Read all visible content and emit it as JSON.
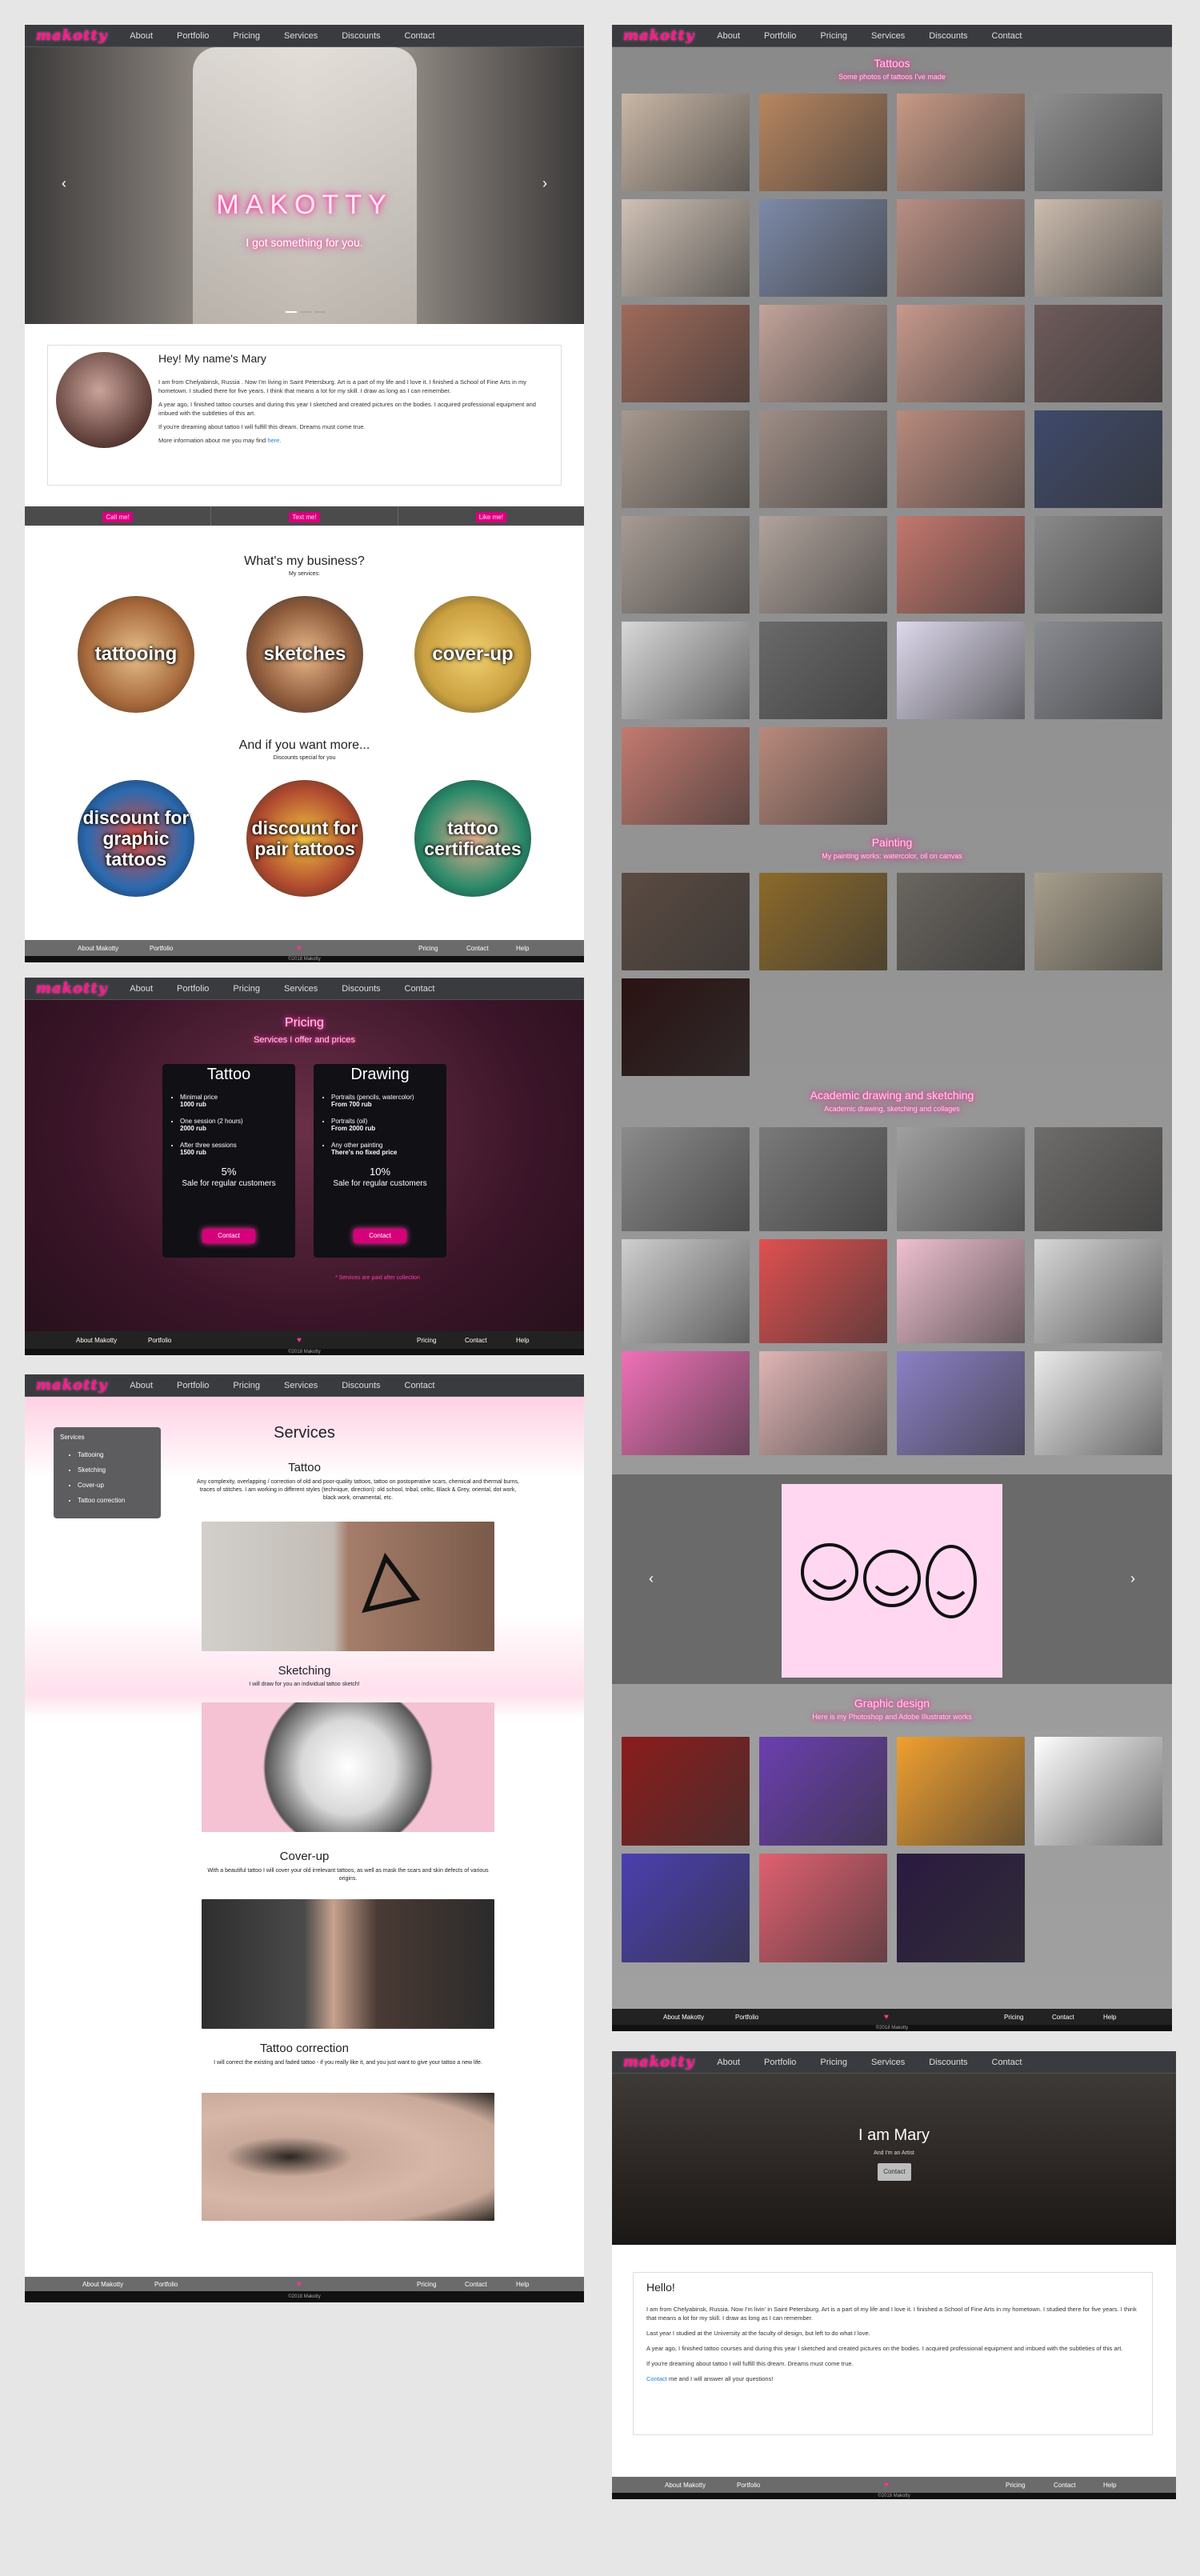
{
  "brand": {
    "logo": "makotty",
    "accent": "#ff1a8c"
  },
  "nav": [
    "About",
    "Portfolio",
    "Pricing",
    "Services",
    "Discounts",
    "Contact"
  ],
  "footer": {
    "about": "About Makotty",
    "portfolio": "Portfolio",
    "pricing": "Pricing",
    "contact": "Contact",
    "help": "Help",
    "copy": "©2018 Makotty"
  },
  "home": {
    "hero_title": "MAKOTTY",
    "hero_sub": "I got something for you.",
    "about_heading": "Hey! My name's Mary",
    "about_p1": "I am from Chelyabinsk, Russia . Now I'm living in Saint Petersburg. Art is a part of my life and I love it. I finished a School of Fine Arts in my hometown. I studied there for five years. I think that means a lot for my skill. I draw as long as I can remember.",
    "about_p2": "A year ago, I finished tattoo courses and during this year I sketched and created pictures on the bodies. I acquired professional equipment and imbued with the subtleties of this art.",
    "about_p3": "If you're dreaming about tattoo I will fulfill this dream. Dreams must come true.",
    "about_p4": "More information about me you may find",
    "about_link": "here.",
    "cta": [
      "Call me!",
      "Text me!",
      "Like me!"
    ],
    "business_title": "What's my business?",
    "business_sub": "My services:",
    "services": [
      "tattooing",
      "sketches",
      "cover-up"
    ],
    "more_title": "And if you want more...",
    "more_sub": "Discounts special for you",
    "discounts": [
      "discount for graphic tattoos",
      "discount for pair tattoos",
      "tattoo certificates"
    ]
  },
  "pricing": {
    "title": "Pricing",
    "sub": "Services I offer and prices",
    "cards": [
      {
        "name": "Tattoo",
        "items": [
          [
            "Minimal price",
            "1000 rub"
          ],
          [
            "One session (2 hours)",
            "2000 rub"
          ],
          [
            "After three sessions",
            "1500 rub"
          ]
        ],
        "sale": "5%",
        "sale_text": "Sale for regular customers",
        "btn": "Contact"
      },
      {
        "name": "Drawing",
        "items": [
          [
            "Portraits (pencils, watercolor)",
            "From 700 rub"
          ],
          [
            "Portraits (oil)",
            "From 2000 rub"
          ],
          [
            "Any other painting",
            "There's no fixed price"
          ]
        ],
        "sale": "10%",
        "sale_text": "Sale for regular customers",
        "btn": "Contact"
      }
    ],
    "note": "* Services are paid after collection"
  },
  "services": {
    "title": "Services",
    "menu_title": "Services",
    "menu": [
      "Tattooing",
      "Sketching",
      "Cover-up",
      "Tattoo correction"
    ],
    "sections": [
      {
        "h": "Tattoo",
        "p": "Any complexity, overlapping / correction of old and poor-quality tattoos, tattoo on postoperative scars, chemical and thermal burns, traces of stitches. I am working in different styles (technique, direction): old school, tribal, celtic, Black & Grey, oriental, dot work, black work, ornamental, etc."
      },
      {
        "h": "Sketching",
        "p": "I will draw for you an individual tattoo sketch!"
      },
      {
        "h": "Cover-up",
        "p": "With a beautiful tattoo I will cover your old irrelevant tattoos, as well as mask the scars and skin defects of various origins."
      },
      {
        "h": "Tattoo correction",
        "p": "I will correct the existing and faded tattoo - if you really like it, and you just want to give your tattoo a new life."
      }
    ]
  },
  "portfolio": {
    "tattoos_title": "Tattoos",
    "tattoos_sub": "Some photos of tattoos I've made",
    "painting_title": "Painting",
    "painting_sub": "My painting works: watercolor, oil on canvas",
    "academic_title": "Academic drawing and sketching",
    "academic_sub": "Academic drawing, sketching and collages",
    "graphic_title": "Graphic design",
    "graphic_sub": "Here is my Photoshop and Adobe Illustrator works",
    "tattoo_colors": [
      "#c9b7a6",
      "#b88660",
      "#c89a86",
      "#8f8f8f",
      "#cfc1b5",
      "#7d8aa8",
      "#b88f83",
      "#ccbcae",
      "#9e6a5a",
      "#c2a49a",
      "#c7998c",
      "#6f5b5b",
      "#a7998e",
      "#9f8e86",
      "#b98b7e",
      "#3f4a6a",
      "#a79c94",
      "#b0a39c",
      "#c3776d",
      "#8a8a8a",
      "#d8d8d8",
      "#6a6a6a",
      "#ddd8ec",
      "#8a8c93",
      "#c37a6f",
      "#b98a7c"
    ],
    "painting_colors": [
      "#5b4b42",
      "#8c6a2a",
      "#6a6660",
      "#a89f8c",
      "#2a1212"
    ],
    "academic_colors": [
      "#8b8b8b",
      "#7a7a7a",
      "#a0a0a0",
      "#6f6d6b",
      "#cfcfcf",
      "#e05050",
      "#efc0d0",
      "#d7d7d7",
      "#f070b8",
      "#e0b5b5",
      "#8c80c5",
      "#ebebeb"
    ],
    "graphic_colors": [
      "#8c1c1c",
      "#6b3fb0",
      "#f0a030",
      "#ffffff",
      "#4a3fb0",
      "#e06070",
      "#2a1a40"
    ]
  },
  "about2": {
    "hero_title": "I am Mary",
    "hero_sub": "And I'm an Artist",
    "hero_btn": "Contact",
    "hello": "Hello!",
    "p1": "I am from Chelyabinsk, Russia. Now I'm livin' in Saint Petersburg. Art is a part of my life and I love it. I finished a School of Fine Arts in my hometown. I studied there for five years. I think that means a lot for my skill. I draw as long as I can remember.",
    "p2": "Last year I studied at the University at the faculty of design, but left to do what I love.",
    "p3": "A year ago, I finished tattoo courses and during this year I sketched and created pictures on the bodies. I acquired professional equipment and imbued with the subtleties of this art.",
    "p4": "If you're dreaming about tattoo I will fulfill this dream. Dreams must come true.",
    "contact_link": "Contact",
    "p5": "me and I will answer all your questions!"
  }
}
